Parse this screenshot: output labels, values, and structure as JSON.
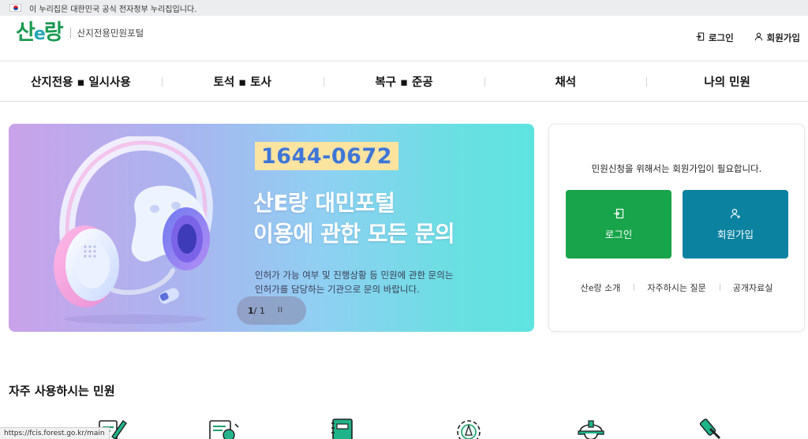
{
  "gov_banner": {
    "text": "이 누리집은 대한민국 공식 전자정부 누리집입니다."
  },
  "header": {
    "logo_mark_a": "산",
    "logo_mark_b": "e",
    "logo_mark_c": "랑",
    "logo_subtitle": "산지전용민원포털",
    "login_label": "로그인",
    "join_label": "회원가입"
  },
  "gnb": {
    "items": [
      {
        "label": "산지전용 ▪ 일시사용"
      },
      {
        "label": "토석 ▪ 토사"
      },
      {
        "label": "복구 ▪ 준공"
      },
      {
        "label": "채석"
      },
      {
        "label": "나의 민원"
      }
    ]
  },
  "hero": {
    "phone": "1644-0672",
    "title_line1": "산E랑 대민포털",
    "title_line2": "이용에 관한 모든 문의",
    "desc_line1": "인허가 가능 여부 및 진행상황 등 민원에 관한 문의는",
    "desc_line2": "인허가를 담당하는 기관으로 문의 바랍니다.",
    "pager_current": "1",
    "pager_total": "/ 1",
    "pause_glyph": "I I"
  },
  "login_card": {
    "notice": "민원신청을 위해서는 회원가입이 필요합니다.",
    "login_button": "로그인",
    "join_button": "회원가입",
    "links": [
      {
        "label": "산e랑 소개"
      },
      {
        "label": "자주하시는 질문"
      },
      {
        "label": "공개자료실"
      }
    ]
  },
  "frequent": {
    "title": "자주 사용하시는 민원",
    "icons": [
      "document-pen-icon",
      "certificate-icon",
      "notebook-icon",
      "gear-pen-icon",
      "worker-helmet-icon",
      "gavel-icon"
    ]
  },
  "status_bar": {
    "url": "https://fcis.forest.go.kr/main"
  },
  "colors": {
    "brand_green": "#18a44a",
    "brand_teal": "#0a82a0",
    "phone_blue": "#3e76d8",
    "phone_highlight": "#fbe3a0"
  }
}
